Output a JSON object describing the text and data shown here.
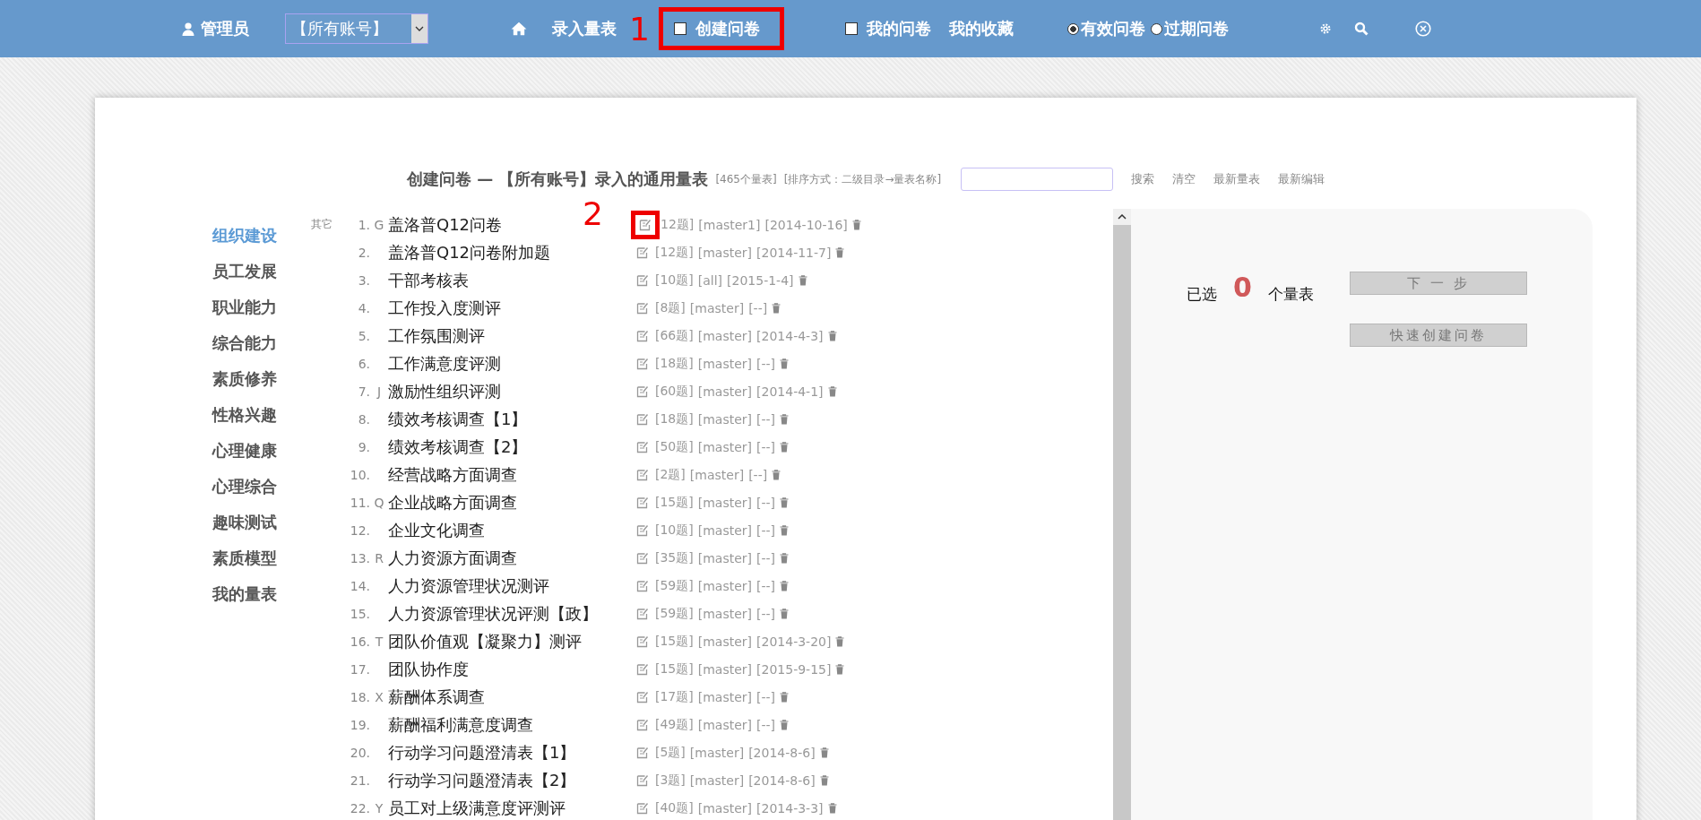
{
  "nav": {
    "user": "管理员",
    "account_select": "【所有账号】",
    "items": [
      {
        "kind": "home"
      },
      {
        "kind": "link",
        "label": "录入量表"
      },
      {
        "kind": "check",
        "label": "创建问卷",
        "checked": false,
        "annotation": "1"
      },
      {
        "kind": "check",
        "label": "我的问卷",
        "checked": false
      },
      {
        "kind": "link",
        "label": "我的收藏"
      },
      {
        "kind": "radio",
        "label": "有效问卷",
        "selected": true
      },
      {
        "kind": "radio",
        "label": "过期问卷",
        "selected": false
      },
      {
        "kind": "settings"
      },
      {
        "kind": "search"
      },
      {
        "kind": "close"
      }
    ]
  },
  "header": {
    "title": "创建问卷 — 【所有账号】录入的通用量表",
    "count": "[465个量表]",
    "sort": "[排序方式：二级目录→量表名称]",
    "actions": [
      "搜索",
      "清空",
      "最新量表",
      "最新编辑"
    ]
  },
  "categories": [
    {
      "label": "组织建设",
      "selected": true
    },
    {
      "label": "员工发展",
      "selected": false
    },
    {
      "label": "职业能力",
      "selected": false
    },
    {
      "label": "综合能力",
      "selected": false
    },
    {
      "label": "素质修养",
      "selected": false
    },
    {
      "label": "性格兴趣",
      "selected": false
    },
    {
      "label": "心理健康",
      "selected": false
    },
    {
      "label": "心理综合",
      "selected": false
    },
    {
      "label": "趣味测试",
      "selected": false
    },
    {
      "label": "素质模型",
      "selected": false
    },
    {
      "label": "我的量表",
      "selected": false
    }
  ],
  "scales": [
    {
      "group": "其它",
      "index": "1.",
      "letter": "G",
      "name": "盖洛普Q12问卷",
      "count": "12题]",
      "owner": "[master1]",
      "date": "[2014-10-16]",
      "annotation": "2"
    },
    {
      "index": "2.",
      "name": "盖洛普Q12问卷附加题",
      "count": "[12题]",
      "owner": "[master]",
      "date": "[2014-11-7]"
    },
    {
      "index": "3.",
      "name": "干部考核表",
      "count": "[10题]",
      "owner": "[all]",
      "date": "[2015-1-4]"
    },
    {
      "index": "4.",
      "name": "工作投入度测评",
      "count": "[8题]",
      "owner": "[master]",
      "date": "[--]"
    },
    {
      "index": "5.",
      "name": "工作氛围测评",
      "count": "[66题]",
      "owner": "[master]",
      "date": "[2014-4-3]"
    },
    {
      "index": "6.",
      "name": "工作满意度评测",
      "count": "[18题]",
      "owner": "[master]",
      "date": "[--]"
    },
    {
      "index": "7.",
      "letter": "J",
      "name": "激励性组织评测",
      "count": "[60题]",
      "owner": "[master]",
      "date": "[2014-4-1]"
    },
    {
      "index": "8.",
      "name": "绩效考核调查【1】",
      "count": "[18题]",
      "owner": "[master]",
      "date": "[--]"
    },
    {
      "index": "9.",
      "name": "绩效考核调查【2】",
      "count": "[50题]",
      "owner": "[master]",
      "date": "[--]"
    },
    {
      "index": "10.",
      "name": "经营战略方面调查",
      "count": "[2题]",
      "owner": "[master]",
      "date": "[--]"
    },
    {
      "index": "11.",
      "letter": "Q",
      "name": "企业战略方面调查",
      "count": "[15题]",
      "owner": "[master]",
      "date": "[--]"
    },
    {
      "index": "12.",
      "name": "企业文化调查",
      "count": "[10题]",
      "owner": "[master]",
      "date": "[--]"
    },
    {
      "index": "13.",
      "letter": "R",
      "name": "人力资源方面调查",
      "count": "[35题]",
      "owner": "[master]",
      "date": "[--]"
    },
    {
      "index": "14.",
      "name": "人力资源管理状况测评",
      "count": "[59题]",
      "owner": "[master]",
      "date": "[--]"
    },
    {
      "index": "15.",
      "name": "人力资源管理状况评测【政】",
      "count": "[59题]",
      "owner": "[master]",
      "date": "[--]"
    },
    {
      "index": "16.",
      "letter": "T",
      "name": "团队价值观【凝聚力】测评",
      "count": "[15题]",
      "owner": "[master]",
      "date": "[2014-3-20]"
    },
    {
      "index": "17.",
      "name": "团队协作度",
      "count": "[15题]",
      "owner": "[master]",
      "date": "[2015-9-15]"
    },
    {
      "index": "18.",
      "letter": "X",
      "name": "薪酬体系调查",
      "count": "[17题]",
      "owner": "[master]",
      "date": "[--]"
    },
    {
      "index": "19.",
      "name": "薪酬福利满意度调查",
      "count": "[49题]",
      "owner": "[master]",
      "date": "[--]"
    },
    {
      "index": "20.",
      "name": "行动学习问题澄清表【1】",
      "count": "[5题]",
      "owner": "[master]",
      "date": "[2014-8-6]"
    },
    {
      "index": "21.",
      "name": "行动学习问题澄清表【2】",
      "count": "[3题]",
      "owner": "[master]",
      "date": "[2014-8-6]"
    },
    {
      "index": "22.",
      "letter": "Y",
      "name": "员工对上级满意度评测评",
      "count": "[40题]",
      "owner": "[master]",
      "date": "[2014-3-3]"
    }
  ],
  "summary": {
    "prefix": "已选",
    "count": "0",
    "suffix": "个量表",
    "buttons": [
      "下 一 步",
      "快速创建问卷"
    ]
  }
}
